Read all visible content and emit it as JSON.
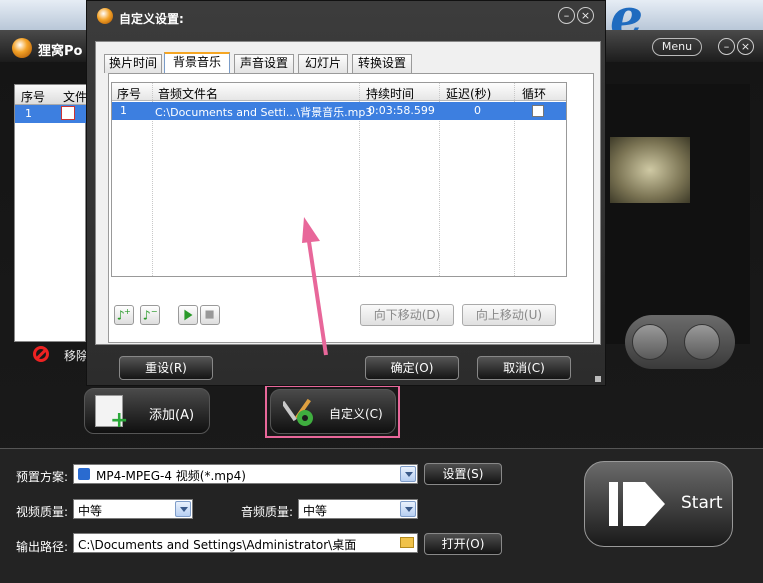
{
  "app": {
    "title": "狸窝Po",
    "menu_label": "Menu",
    "brand_fragment": "e",
    "file_list": {
      "headers": [
        "序号",
        "文件"
      ],
      "rows": [
        {
          "index": "1"
        }
      ]
    },
    "remove_label": "移除",
    "add_button_label": "添加(A)",
    "custom_button_label": "自定义(C)",
    "preset": {
      "label": "预置方案:",
      "value": "MP4-MPEG-4 视频(*.mp4)",
      "button": "设置(S)"
    },
    "video_quality": {
      "label": "视频质量:",
      "value": "中等"
    },
    "audio_quality": {
      "label": "音频质量:",
      "value": "中等"
    },
    "output_path": {
      "label": "输出路径:",
      "value": "C:\\Documents and Settings\\Administrator\\桌面",
      "button": "打开(O)"
    },
    "start_label": "Start"
  },
  "dialog": {
    "title": "自定义设置:",
    "tabs": [
      {
        "label": "换片时间"
      },
      {
        "label": "背景音乐"
      },
      {
        "label": "声音设置"
      },
      {
        "label": "幻灯片"
      },
      {
        "label": "转换设置"
      }
    ],
    "active_tab": "背景音乐",
    "table": {
      "headers": [
        "序号",
        "音频文件名",
        "持续时间",
        "延迟(秒)",
        "循环"
      ],
      "rows": [
        {
          "index": "1",
          "file": "C:\\Documents and Setti...\\背景音乐.mp3",
          "duration": "0:03:58.599",
          "delay": "0",
          "loop": false
        }
      ]
    },
    "move_down_label": "向下移动(D)",
    "move_up_label": "向上移动(U)",
    "reset_label": "重设(R)",
    "ok_label": "确定(O)",
    "cancel_label": "取消(C)"
  },
  "colors": {
    "highlight": "#e8679a",
    "selection": "#3d7fe0",
    "active_tab_accent": "#f5a623"
  }
}
